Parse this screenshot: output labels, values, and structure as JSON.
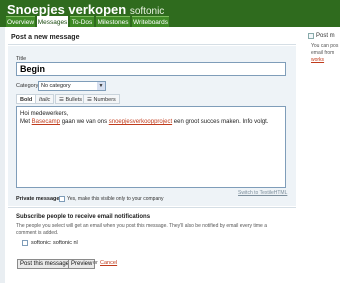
{
  "header": {
    "title": "Snoepjes verkopen",
    "subtitle": "softonic"
  },
  "tabs": [
    {
      "label": "Overview",
      "active": false
    },
    {
      "label": "Messages",
      "active": true
    },
    {
      "label": "To-Dos",
      "active": false
    },
    {
      "label": "Milestones",
      "active": false
    },
    {
      "label": "Writeboards",
      "active": false
    }
  ],
  "form": {
    "section_title": "Post a new message",
    "title_label": "Title",
    "title_value": "Begin",
    "category_label": "Category",
    "category_value": "No category",
    "toolbar": {
      "bold": "Bold",
      "italic": "Italic",
      "bullets": "Bullets",
      "numbers": "Numbers"
    },
    "body": {
      "line1": "Hoi medewerkers,",
      "line2_prefix": "Met ",
      "link1": "Basecamp",
      "line2_middle": " gaan we van ons ",
      "link2": "snoepjesverkoopproject",
      "line2_suffix": " een groot succes maken. Info volgt."
    },
    "switch_link": "Switch to TextileHTML",
    "private_label": "Private message?",
    "private_text": "Yes, make this visible only to your company"
  },
  "subscribe": {
    "title": "Subscribe people to receive email notifications",
    "desc": "The people you select will get an email when you post this message. They'll also be notified by email every time a comment is added.",
    "person": "softonic: softonic nl"
  },
  "actions": {
    "post": "Post this message",
    "preview": "Preview",
    "or": "or",
    "cancel": "Cancel"
  },
  "sidebar": {
    "title": "Post m",
    "line1": "You can pos",
    "line2": "email from ",
    "link": "works"
  },
  "colors": {
    "header": "#2f6b1e",
    "tab": "#3f8a26",
    "link": "#c03b1c",
    "form_bg": "#eef3f7"
  }
}
